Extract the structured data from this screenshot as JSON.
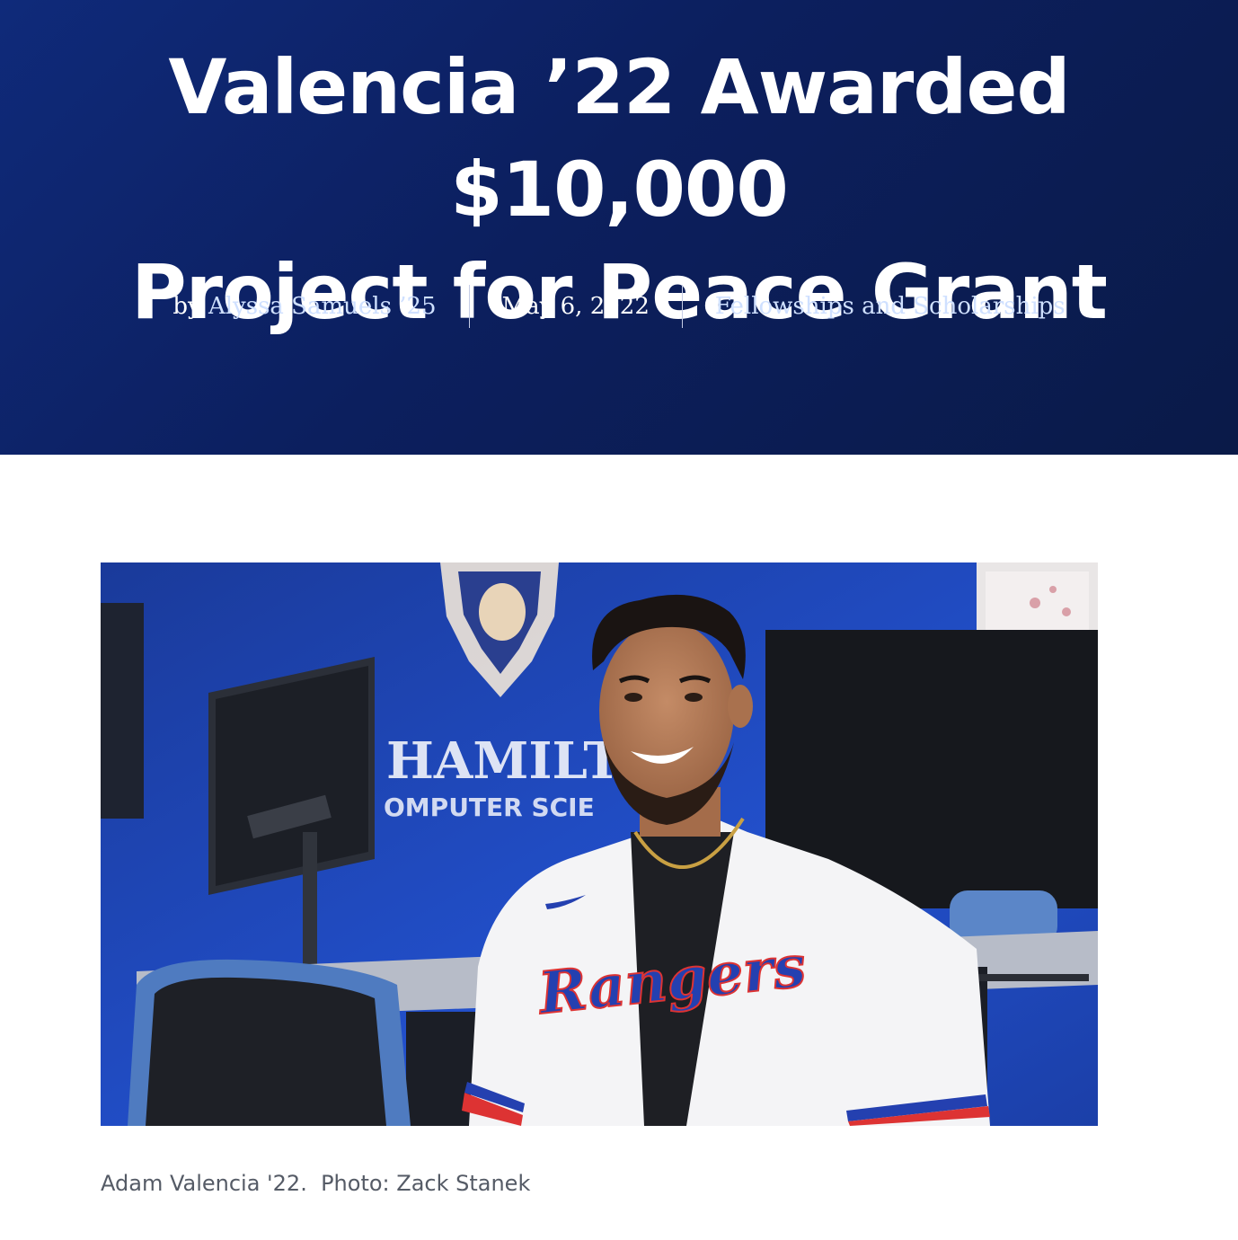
{
  "article": {
    "title_line1": "Valencia ’22 Awarded $10,000",
    "title_line2": "Project for Peace Grant",
    "byline_prefix": "by",
    "author": "Alyssa Samuels ’25",
    "date": "May 6, 2022",
    "category": "Fellowships and Scholarships"
  },
  "photo": {
    "sign_line1": "HAMILTO",
    "sign_line2": "OMPUTER SCIE",
    "jersey_text": "Rangers",
    "caption": "Adam Valencia '22.  Photo: Zack Stanek"
  },
  "colors": {
    "hero_bg": "#0c1f5e",
    "link": "#cfe0ff",
    "wall_blue": "#1f45b8"
  }
}
